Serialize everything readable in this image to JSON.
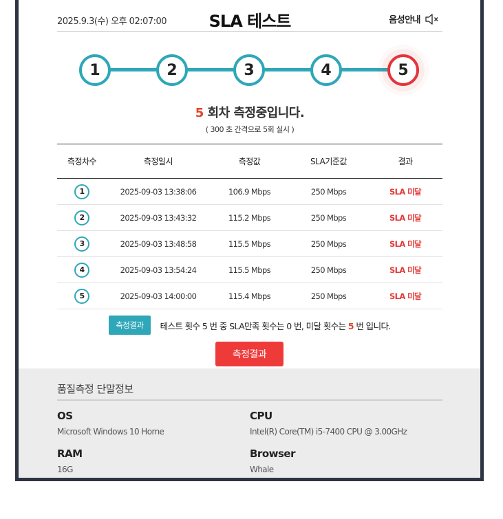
{
  "header": {
    "datetime": "2025.9.3(수) 오후 02:07:00",
    "title": "SLA 테스트",
    "audio_label": "음성안내",
    "audio_icon": "speaker-muted-icon"
  },
  "steps": [
    "1",
    "2",
    "3",
    "4",
    "5"
  ],
  "active_step": 5,
  "status": {
    "round": "5",
    "text": "회차 측정중입니다.",
    "sub": "( 300 초 간격으로 5회 실시 )"
  },
  "table": {
    "headers": [
      "측정차수",
      "측정일시",
      "측정값",
      "SLA기준값",
      "결과"
    ],
    "rows": [
      {
        "no": "1",
        "datetime": "2025-09-03 13:38:06",
        "value": "106.9 Mbps",
        "standard": "250 Mbps",
        "result": "SLA 미달"
      },
      {
        "no": "2",
        "datetime": "2025-09-03 13:43:32",
        "value": "115.2 Mbps",
        "standard": "250 Mbps",
        "result": "SLA 미달"
      },
      {
        "no": "3",
        "datetime": "2025-09-03 13:48:58",
        "value": "115.5 Mbps",
        "standard": "250 Mbps",
        "result": "SLA 미달"
      },
      {
        "no": "4",
        "datetime": "2025-09-03 13:54:24",
        "value": "115.5 Mbps",
        "standard": "250 Mbps",
        "result": "SLA 미달"
      },
      {
        "no": "5",
        "datetime": "2025-09-03 14:00:00",
        "value": "115.4 Mbps",
        "standard": "250 Mbps",
        "result": "SLA 미달"
      }
    ]
  },
  "summary": {
    "tag": "측정결과",
    "text_before": "테스트 횟수 5 번 중 SLA만족 횟수는 0 번, 미달 횟수는",
    "fail_count": "5",
    "text_after": "번 입니다."
  },
  "result_button": "측정결과",
  "device": {
    "title": "품질측정 단말정보",
    "items": [
      {
        "key": "OS",
        "value": "Microsoft Windows 10 Home"
      },
      {
        "key": "CPU",
        "value": "Intel(R) Core(TM) i5-7400 CPU @ 3.00GHz"
      },
      {
        "key": "RAM",
        "value": "16G"
      },
      {
        "key": "Browser",
        "value": "Whale"
      }
    ]
  },
  "colors": {
    "accent": "#2ea7b8",
    "alert": "#e4343b",
    "frame": "#2e3442"
  }
}
